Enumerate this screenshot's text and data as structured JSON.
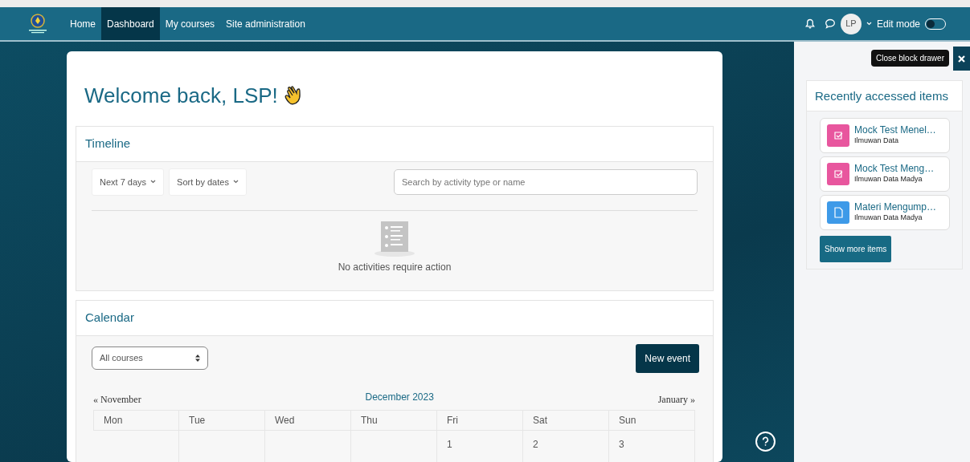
{
  "navbar": {
    "items": [
      {
        "label": "Home",
        "selected": false
      },
      {
        "label": "Dashboard",
        "selected": true
      },
      {
        "label": "My courses",
        "selected": false
      },
      {
        "label": "Site administration",
        "selected": false
      }
    ],
    "avatar": "LP",
    "edit_mode": {
      "label": "Edit mode",
      "on": false
    }
  },
  "page": {
    "title": "Welcome back, LSP!"
  },
  "timeline": {
    "title": "Timeline",
    "filters": [
      "Next 7 days",
      "Sort by dates"
    ],
    "search": {
      "placeholder": "Search by activity type or name"
    },
    "empty_message": "No activities require action"
  },
  "calendar": {
    "title": "Calendar",
    "course_select": "All courses",
    "new_event": "New event",
    "prev": "« November",
    "month": "December 2023",
    "next": "January »",
    "weekdays": [
      "Mon",
      "Tue",
      "Wed",
      "Thu",
      "Fri",
      "Sat",
      "Sun"
    ],
    "weeks": [
      {
        "days": [
          "1",
          "2",
          "3"
        ]
      }
    ]
  },
  "drawer": {
    "tooltip": "Close block drawer",
    "title": "Recently accessed items",
    "items": [
      {
        "kind": "quiz",
        "name": "Mock Test Menel…",
        "course": "Ilmuwan Data"
      },
      {
        "kind": "quiz",
        "name": "Mock Test Meng…",
        "course": "Ilmuwan Data Madya"
      },
      {
        "kind": "resource",
        "name": "Materi Mengump…",
        "course": "Ilmuwan Data Madya"
      }
    ],
    "button": "Show more items"
  }
}
